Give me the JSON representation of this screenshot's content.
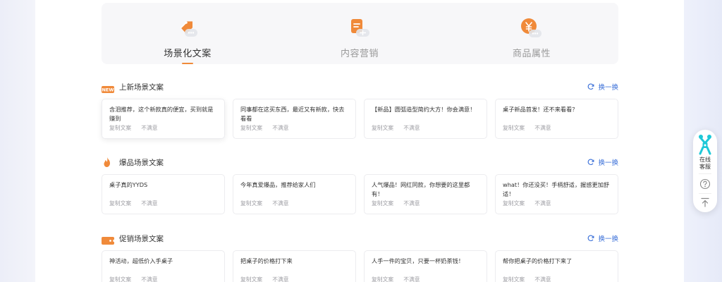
{
  "tabs": [
    {
      "label": "场景化文案",
      "icon": "tag-icon",
      "active": true
    },
    {
      "label": "内容营销",
      "icon": "document-icon",
      "active": false
    },
    {
      "label": "商品属性",
      "icon": "yen-icon",
      "active": false
    }
  ],
  "refresh_label": "换一换",
  "sections": [
    {
      "title": "上新场景文案",
      "icon": "new-badge-icon",
      "badge_text": "NEW",
      "cards": [
        {
          "text": "含泪推荐，这个新款真的便宜，买到就是赚到",
          "copy": "复制文案",
          "dislike": "不满意"
        },
        {
          "text": "同事都在这买东西，最近又有新款，快去看看",
          "copy": "复制文案",
          "dislike": "不满意"
        },
        {
          "text": "【新品】圆弧造型简约大方！你会满意！",
          "copy": "复制文案",
          "dislike": "不满意"
        },
        {
          "text": "桌子新品首发！还不来看看？",
          "copy": "复制文案",
          "dislike": "不满意"
        }
      ]
    },
    {
      "title": "爆品场景文案",
      "icon": "flame-icon",
      "cards": [
        {
          "text": "桌子真的YYDS",
          "copy": "复制文案",
          "dislike": "不满意"
        },
        {
          "text": "今年真爱爆品，推荐给家人们",
          "copy": "复制文案",
          "dislike": "不满意"
        },
        {
          "text": "人气爆品！网红同款，你想要的这里都有！",
          "copy": "复制文案",
          "dislike": "不满意"
        },
        {
          "text": "what！你还没买！手柄舒适，握感更加舒适！",
          "copy": "复制文案",
          "dislike": "不满意"
        }
      ]
    },
    {
      "title": "促销场景文案",
      "icon": "coupon-icon",
      "cards": [
        {
          "text": "神活动，超低价入手桌子",
          "copy": "复制文案",
          "dislike": "不满意"
        },
        {
          "text": "把桌子的价格打下来",
          "copy": "复制文案",
          "dislike": "不满意"
        },
        {
          "text": "人手一件的宝贝，只要一杯奶茶钱！",
          "copy": "复制文案",
          "dislike": "不满意"
        },
        {
          "text": "帮你把桌子的价格打下来了",
          "copy": "复制文案",
          "dislike": "不满意"
        }
      ]
    }
  ],
  "widget": {
    "line1": "在线",
    "line2": "客服",
    "icons": [
      "robot-icon",
      "help-icon",
      "back-to-top-icon"
    ]
  },
  "colors": {
    "accent": "#f08a3a",
    "link": "#3a6fd8",
    "widget_teal": "#1ec8d8"
  }
}
